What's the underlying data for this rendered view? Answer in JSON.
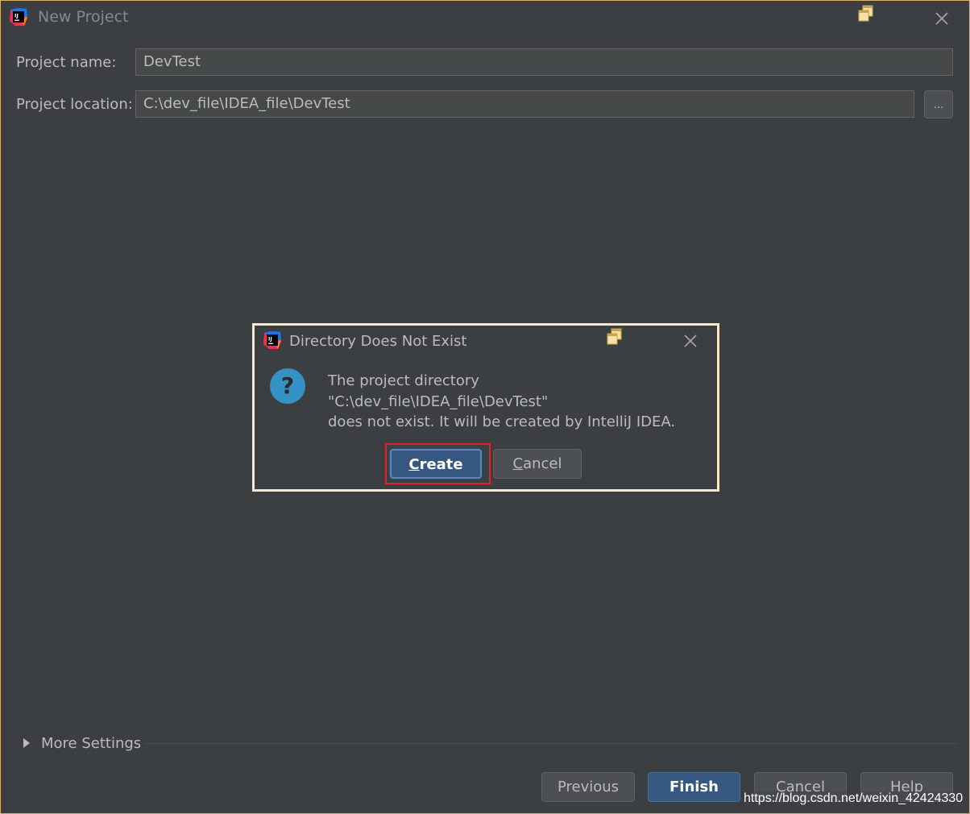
{
  "window": {
    "title": "New Project",
    "logo_icon": "intellij-idea-icon",
    "restore_icon": "restore-window-icon",
    "close_icon": "close-icon"
  },
  "form": {
    "project_name_label": "Project name:",
    "project_name_value": "DevTest",
    "project_location_label": "Project location:",
    "project_location_value": "C:\\dev_file\\IDEA_file\\DevTest",
    "browse_label": "..."
  },
  "more_settings": {
    "label": "More Settings",
    "icon": "expand-triangle-icon"
  },
  "footer": {
    "previous_label": "Previous",
    "finish_label": "Finish",
    "cancel_label": "Cancel",
    "help_label": "Help"
  },
  "dialog": {
    "title": "Directory Does Not Exist",
    "icon": "question-icon",
    "message_lines": [
      "The project directory",
      "\"C:\\dev_file\\IDEA_file\\DevTest\"",
      "does not exist. It will be created by IntelliJ IDEA."
    ],
    "create_mnemonic": "C",
    "create_rest": "reate",
    "cancel_mnemonic": "C",
    "cancel_rest": "ancel"
  },
  "watermark": "https://blog.csdn.net/weixin_42424330",
  "colors": {
    "background": "#3c3f41",
    "text": "#bbbbbb",
    "default_button": "#365880",
    "window_border": "#d8b466",
    "dialog_border": "#fce8c3",
    "highlight": "#e0202a",
    "question_icon": "#3592c4"
  }
}
